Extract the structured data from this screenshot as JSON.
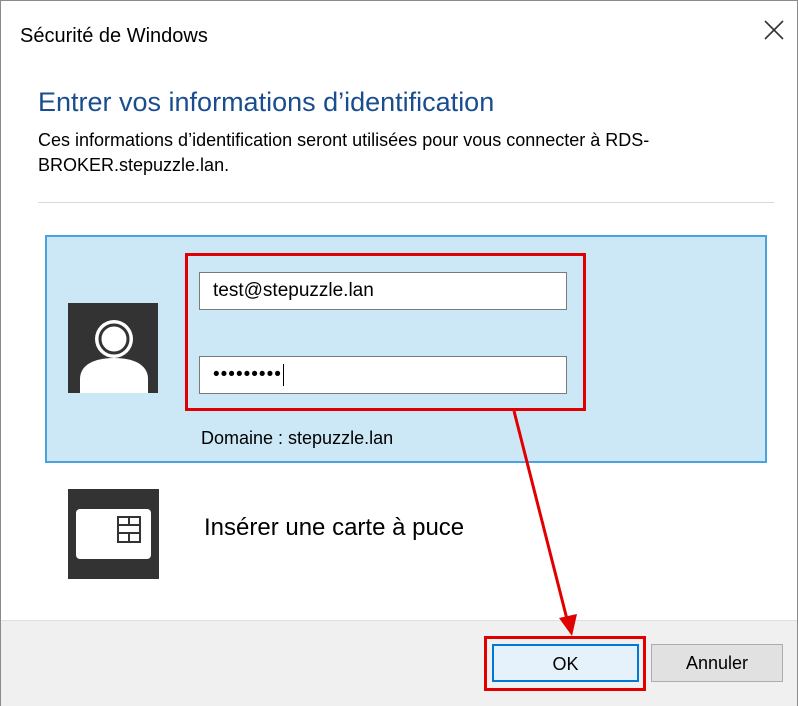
{
  "window": {
    "title": "Sécurité de Windows"
  },
  "dialog": {
    "heading": "Entrer vos informations d’identification",
    "description": "Ces informations d’identification seront utilisées pour vous connecter à RDS-BROKER.stepuzzle.lan."
  },
  "credentials": {
    "username_value": "test@stepuzzle.lan",
    "password_masked": "•••••••••",
    "domain_text": "Domaine : stepuzzle.lan"
  },
  "smartcard": {
    "label": "Insérer une carte à puce"
  },
  "buttons": {
    "ok_label": "OK",
    "cancel_label": "Annuler"
  },
  "icons": {
    "close": "close-icon",
    "user": "user-avatar-icon",
    "smartcard": "smart-card-icon"
  },
  "colors": {
    "heading": "#1a4d8f",
    "selection_bg": "#cce8f6",
    "selection_border": "#4aa3df",
    "annotation": "#e00000",
    "primary_button_border": "#0078d7"
  }
}
